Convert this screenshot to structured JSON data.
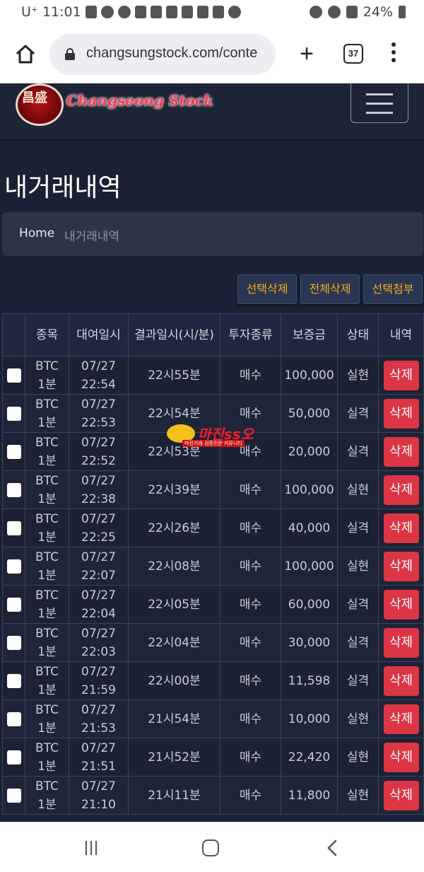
{
  "status_bar": {
    "carrier": "U⁺",
    "time": "11:01",
    "battery": "24%",
    "icons": [
      "link-icon",
      "gear-icon",
      "heart-icon",
      "shield-icon",
      "shield-icon",
      "shield-icon",
      "shield-icon",
      "shield-icon",
      "shield-icon",
      "bird-icon",
      "alarm-icon",
      "wifi-icon",
      "signal-icon",
      "battery-icon"
    ]
  },
  "browser": {
    "url": "changsungstock.com/conte",
    "tab_count": "37"
  },
  "site": {
    "logo_chars": "昌盛",
    "logo_text": "Changseong Stock"
  },
  "page": {
    "title": "내거래내역",
    "breadcrumb": {
      "home": "Home",
      "current": "내거래내역"
    }
  },
  "actions": {
    "delete_selected": "선택삭제",
    "delete_all": "전체삭제",
    "attach_selected": "선택첨부"
  },
  "table": {
    "headers": [
      "종목",
      "대여일시",
      "결과일시(시/분)",
      "투자종류",
      "보증금",
      "상태",
      "내역"
    ],
    "rows": [
      {
        "symbol": "BTC",
        "period": "1분",
        "date": "07/27",
        "time": "22:54",
        "result": "22시55분",
        "type": "매수",
        "deposit": "100,000",
        "status": "실현",
        "action": "삭제",
        "win": true
      },
      {
        "symbol": "BTC",
        "period": "1분",
        "date": "07/27",
        "time": "22:53",
        "result": "22시54분",
        "type": "매수",
        "deposit": "50,000",
        "status": "실격",
        "action": "삭제",
        "win": false
      },
      {
        "symbol": "BTC",
        "period": "1분",
        "date": "07/27",
        "time": "22:52",
        "result": "22시53분",
        "type": "매수",
        "deposit": "20,000",
        "status": "실격",
        "action": "삭제",
        "win": false
      },
      {
        "symbol": "BTC",
        "period": "1분",
        "date": "07/27",
        "time": "22:38",
        "result": "22시39분",
        "type": "매수",
        "deposit": "100,000",
        "status": "실현",
        "action": "삭제",
        "win": true
      },
      {
        "symbol": "BTC",
        "period": "1분",
        "date": "07/27",
        "time": "22:25",
        "result": "22시26분",
        "type": "매수",
        "deposit": "40,000",
        "status": "실격",
        "action": "삭제",
        "win": false
      },
      {
        "symbol": "BTC",
        "period": "1분",
        "date": "07/27",
        "time": "22:07",
        "result": "22시08분",
        "type": "매수",
        "deposit": "100,000",
        "status": "실현",
        "action": "삭제",
        "win": true
      },
      {
        "symbol": "BTC",
        "period": "1분",
        "date": "07/27",
        "time": "22:04",
        "result": "22시05분",
        "type": "매수",
        "deposit": "60,000",
        "status": "실격",
        "action": "삭제",
        "win": false
      },
      {
        "symbol": "BTC",
        "period": "1분",
        "date": "07/27",
        "time": "22:03",
        "result": "22시04분",
        "type": "매수",
        "deposit": "30,000",
        "status": "실격",
        "action": "삭제",
        "win": false
      },
      {
        "symbol": "BTC",
        "period": "1분",
        "date": "07/27",
        "time": "21:59",
        "result": "22시00분",
        "type": "매수",
        "deposit": "11,598",
        "status": "실격",
        "action": "삭제",
        "win": false
      },
      {
        "symbol": "BTC",
        "period": "1분",
        "date": "07/27",
        "time": "21:53",
        "result": "21시54분",
        "type": "매수",
        "deposit": "10,000",
        "status": "실현",
        "action": "삭제",
        "win": true
      },
      {
        "symbol": "BTC",
        "period": "1분",
        "date": "07/27",
        "time": "21:51",
        "result": "21시52분",
        "type": "매수",
        "deposit": "22,420",
        "status": "실현",
        "action": "삭제",
        "win": true
      },
      {
        "symbol": "BTC",
        "period": "1분",
        "date": "07/27",
        "time": "21:10",
        "result": "21시11분",
        "type": "매수",
        "deposit": "11,800",
        "status": "실현",
        "action": "삭제",
        "win": true
      }
    ]
  },
  "watermark": {
    "title": "마진ss오",
    "subtitle": "마진거래 검증전문 커뮤니티"
  },
  "colors": {
    "win": "#2fb35a",
    "lose": "#e0383e",
    "delete_button": "#dc3545",
    "action_text": "#f4a81c"
  }
}
